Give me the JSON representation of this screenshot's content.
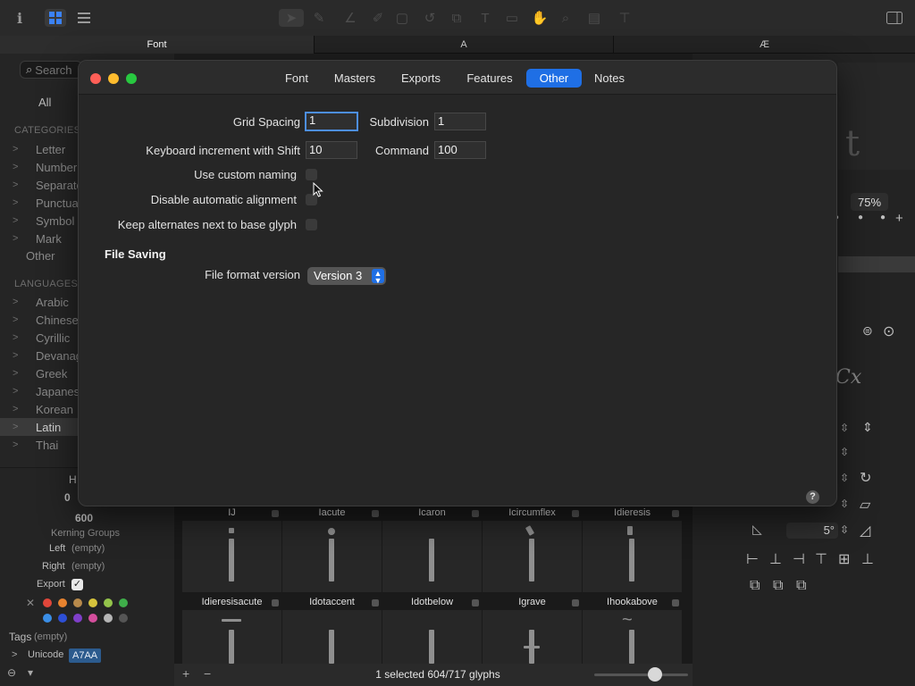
{
  "toolbar": {
    "icons": [
      "info-icon",
      "grid-view-icon",
      "list-view-icon",
      "select-tool-icon",
      "pen-tool-icon",
      "draw-tool-icon",
      "rectangle-tool-icon",
      "text-tool-icon",
      "hand-tool-icon",
      "zoom-tool-icon",
      "measure-tool-icon",
      "sidebar-toggle-icon"
    ]
  },
  "tabs": [
    {
      "label": "Font"
    },
    {
      "label": "A"
    },
    {
      "label": "Æ"
    }
  ],
  "sidebar": {
    "search_placeholder": "Search",
    "all_label": "All",
    "categories_heading": "CATEGORIES",
    "categories": [
      "Letter",
      "Number",
      "Separator",
      "Punctuation",
      "Symbol",
      "Mark"
    ],
    "other_label": "Other",
    "languages_heading": "LANGUAGES",
    "languages": [
      "Arabic",
      "Chinese",
      "Cyrillic",
      "Devanagari",
      "Greek",
      "Japanese",
      "Korean",
      "Latin",
      "Thai"
    ],
    "selected_language": "Latin"
  },
  "info": {
    "h_label": "H",
    "zero_value": "0",
    "width_value": "600",
    "kerning_heading": "Kerning Groups",
    "left_label": "Left",
    "left_value": "(empty)",
    "right_label": "Right",
    "right_value": "(empty)",
    "export_label": "Export",
    "export_check": "✓",
    "tags_label": "Tags",
    "tags_value": "(empty)",
    "unicode_label": "Unicode",
    "unicode_value": "A7AA",
    "colors_row1": [
      "#e0463a",
      "#e8832f",
      "#b88a4b",
      "#d7c43c",
      "#94c44b",
      "#3fae4a"
    ],
    "colors_row2": [
      "#3a8ee6",
      "#2d4fd6",
      "#7f3fc9",
      "#d44e9c",
      "#b5b5b5",
      "#555555"
    ]
  },
  "glyphs": {
    "row1": [
      "IJ",
      "Iacute",
      "Icaron",
      "Icircumflex",
      "Idieresis"
    ],
    "row2": [
      "Idieresisacute",
      "Idotaccent",
      "Idotbelow",
      "Igrave",
      "Ihookabove"
    ],
    "status": "1 selected 604/717 glyphs",
    "add_label": "+",
    "remove_label": "−",
    "size_slider": 0.65
  },
  "right_panel": {
    "glyph_char": "t",
    "zoom": "75%",
    "sample": "Cx",
    "angle": "5°"
  },
  "dialog": {
    "tabs": [
      "Font",
      "Masters",
      "Exports",
      "Features",
      "Other",
      "Notes"
    ],
    "active_tab": "Other",
    "grid_spacing_label": "Grid Spacing",
    "grid_spacing_value": "1",
    "subdivision_label": "Subdivision",
    "subdivision_value": "1",
    "keyboard_shift_label": "Keyboard increment with Shift",
    "keyboard_shift_value": "10",
    "command_label": "Command",
    "command_value": "100",
    "custom_naming_label": "Use custom naming",
    "custom_naming_checked": false,
    "disable_alignment_label": "Disable automatic alignment",
    "disable_alignment_checked": false,
    "keep_alternates_label": "Keep alternates next to base glyph",
    "keep_alternates_checked": false,
    "file_saving_heading": "File Saving",
    "file_format_label": "File format version",
    "file_format_value": "Version 3",
    "help_label": "?"
  }
}
